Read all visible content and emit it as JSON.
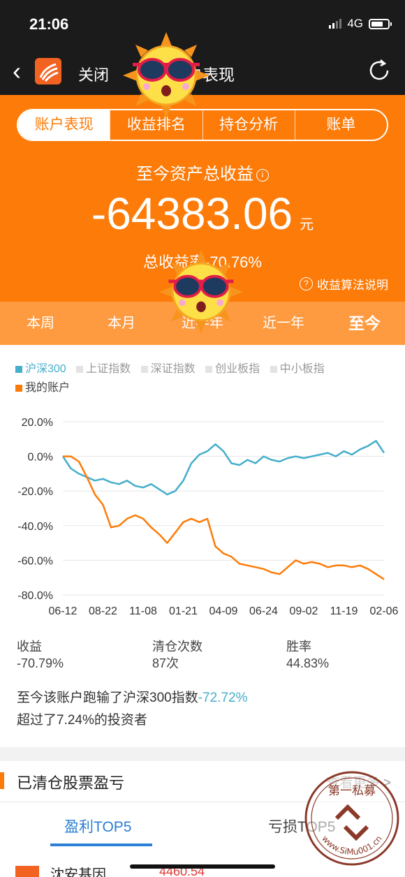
{
  "status_bar": {
    "time": "21:06",
    "network": "4G"
  },
  "nav": {
    "back_symbol": "‹",
    "close_label": "关闭",
    "title": "账户表现"
  },
  "tabs": [
    {
      "label": "账户表现",
      "active": true
    },
    {
      "label": "收益排名",
      "active": false
    },
    {
      "label": "持仓分析",
      "active": false
    },
    {
      "label": "账单",
      "active": false
    }
  ],
  "summary_header": {
    "label": "至今资产总收益",
    "info_symbol": "i",
    "value": "-64383.06",
    "unit": "元",
    "rate_label": "总收益率",
    "rate_value": "-70.76%",
    "algo_symbol": "?",
    "algo_link": "收益算法说明"
  },
  "periods": [
    {
      "label": "本周",
      "active": false
    },
    {
      "label": "本月",
      "active": false
    },
    {
      "label": "近半年",
      "active": false
    },
    {
      "label": "近一年",
      "active": false
    },
    {
      "label": "至今",
      "active": true
    }
  ],
  "colors": {
    "orange": "#fd7b08",
    "blue": "#45aecb",
    "grey_legend": "#e3e3e3",
    "link_blue": "#2b7fd4"
  },
  "chart_data": {
    "type": "line",
    "legend": [
      {
        "name": "沪深300",
        "color": "#45aecb",
        "active": true
      },
      {
        "name": "上证指数",
        "color": "#e3e3e3",
        "active": false
      },
      {
        "name": "深证指数",
        "color": "#e3e3e3",
        "active": false
      },
      {
        "name": "创业板指",
        "color": "#e3e3e3",
        "active": false
      },
      {
        "name": "中小板指",
        "color": "#e3e3e3",
        "active": false
      },
      {
        "name": "我的账户",
        "color": "#fd7b08",
        "active": true
      }
    ],
    "x_ticks": [
      "06-12",
      "08-22",
      "11-08",
      "01-21",
      "04-09",
      "06-24",
      "09-02",
      "11-19",
      "02-06"
    ],
    "y_ticks": [
      "20.0%",
      "0.0%",
      "-20.0%",
      "-40.0%",
      "-60.0%",
      "-80.0%"
    ],
    "ylim": [
      -80,
      20
    ],
    "x": [
      0,
      2,
      4,
      6,
      8,
      10,
      12,
      14,
      16,
      18,
      20,
      22,
      24,
      26,
      28,
      30,
      32,
      34,
      36,
      38,
      40,
      42,
      44,
      46,
      48,
      50,
      52,
      54,
      56,
      58,
      60,
      62,
      64,
      66,
      68,
      70,
      72,
      74,
      76,
      78,
      80
    ],
    "series": [
      {
        "name": "沪深300",
        "values": [
          0,
          -7,
          -10,
          -12,
          -14,
          -13,
          -15,
          -16,
          -14,
          -17,
          -18,
          -16,
          -19,
          -22,
          -20,
          -14,
          -4,
          1,
          3,
          7,
          3,
          -4,
          -5,
          -2,
          -4,
          0,
          -2,
          -3,
          -1,
          0,
          -1,
          0,
          1,
          2,
          0,
          3,
          1,
          4,
          6,
          9,
          2
        ]
      },
      {
        "name": "我的账户",
        "values": [
          0,
          0,
          -3,
          -12,
          -22,
          -28,
          -41,
          -40,
          -36,
          -34,
          -36,
          -41,
          -45,
          -50,
          -44,
          -38,
          -36,
          -38,
          -36,
          -52,
          -56,
          -58,
          -62,
          -63,
          -64,
          -65,
          -67,
          -68,
          -64,
          -60,
          -62,
          -61,
          -62,
          -64,
          -63,
          -63,
          -64,
          -63,
          -65,
          -68,
          -71
        ]
      }
    ]
  },
  "stats": [
    {
      "label": "收益",
      "value": "-70.79%"
    },
    {
      "label": "清仓次数",
      "value": "87次"
    },
    {
      "label": "胜率",
      "value": "44.83%"
    }
  ],
  "summary": {
    "line1_prefix": "至今该账户跑输了沪深300指数",
    "line1_value": "-72.72%",
    "line2": "超过了7.24%的投资者"
  },
  "cleared": {
    "title": "已清仓股票盈亏",
    "more": "查看更多 >",
    "tabs": [
      "盈利TOP5",
      "亏损TOP5"
    ],
    "first_row_name": "沈安基因",
    "first_row_value": "4460.54"
  },
  "watermark": {
    "top_text": "第一私募",
    "site": "www.SiMu001.cn"
  }
}
